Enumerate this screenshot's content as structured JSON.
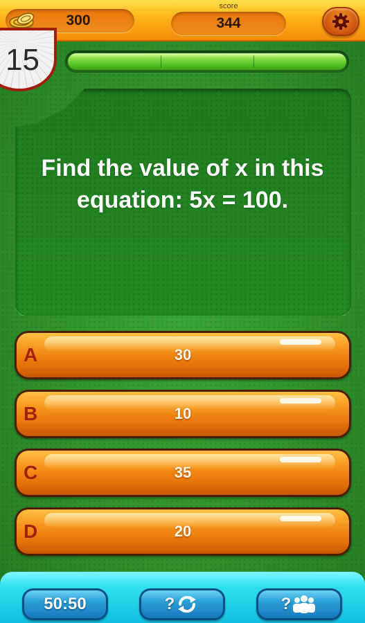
{
  "header": {
    "coins": "300",
    "score_label": "score",
    "score": "344",
    "icons": {
      "coins": "coin-stack-icon",
      "settings": "gear-icon"
    }
  },
  "timer": {
    "seconds": "15"
  },
  "progress": {
    "fraction": 1.0,
    "segments": 3
  },
  "question": {
    "text": "Find the value of x in this equation: 5x = 100."
  },
  "answers": [
    {
      "letter": "A",
      "value": "30"
    },
    {
      "letter": "B",
      "value": "10"
    },
    {
      "letter": "C",
      "value": "35"
    },
    {
      "letter": "D",
      "value": "20"
    }
  ],
  "lifelines": {
    "fifty_label": "50:50",
    "swap_label": "?",
    "audience_label": "?",
    "icons": {
      "swap": "refresh-arrows-icon",
      "audience": "people-group-icon"
    }
  },
  "colors": {
    "background_green": "#2f8f2c",
    "answer_orange": "#f7961c",
    "answer_letter": "#a3200a",
    "lifeline_blue": "#2a9fd6",
    "topbar_orange": "#ffb316"
  }
}
